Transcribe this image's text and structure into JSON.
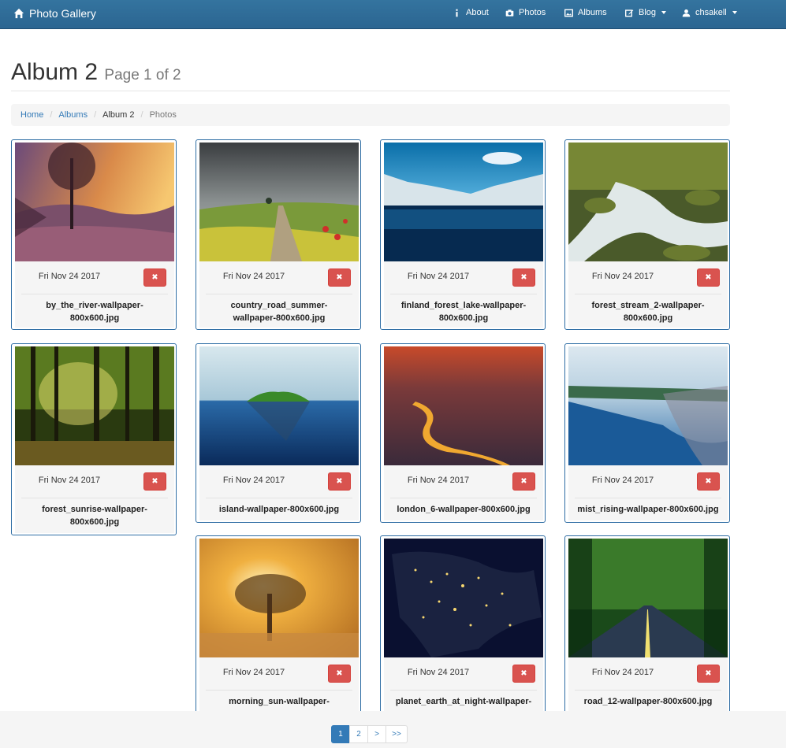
{
  "navbar": {
    "brand": "Photo Gallery",
    "items": [
      {
        "label": "About",
        "icon": "info-icon"
      },
      {
        "label": "Photos",
        "icon": "camera-icon"
      },
      {
        "label": "Albums",
        "icon": "picture-icon"
      },
      {
        "label": "Blog",
        "icon": "edit-icon",
        "dropdown": true
      },
      {
        "label": "chsakell",
        "icon": "user-icon",
        "dropdown": true
      }
    ]
  },
  "header": {
    "title": "Album 2",
    "subtitle": "Page 1 of 2"
  },
  "breadcrumb": [
    "Home",
    "Albums",
    "Album 2",
    "Photos"
  ],
  "delete_glyph": "✖",
  "photos": [
    {
      "date": "Fri Nov 24 2017",
      "line1": "by_the_river-wallpaper-",
      "line2": "800x600.jpg",
      "scene": "river-sunset"
    },
    {
      "date": "Fri Nov 24 2017",
      "line1": "country_road_summer-",
      "line2": "wallpaper-800x600.jpg",
      "scene": "country-road"
    },
    {
      "date": "Fri Nov 24 2017",
      "line1": "finland_forest_lake-wallpaper-",
      "line2": "800x600.jpg",
      "scene": "forest-lake"
    },
    {
      "date": "Fri Nov 24 2017",
      "line1": "forest_stream_2-wallpaper-",
      "line2": "800x600.jpg",
      "scene": "forest-stream"
    },
    {
      "date": "Fri Nov 24 2017",
      "line1": "forest_sunrise-wallpaper-",
      "line2": "800x600.jpg",
      "scene": "forest-sunrise"
    },
    {
      "date": "Fri Nov 24 2017",
      "line1": "island-wallpaper-800x600.jpg",
      "line2": "",
      "scene": "island"
    },
    {
      "date": "Fri Nov 24 2017",
      "line1": "london_6-wallpaper-800x600.jpg",
      "line2": "",
      "scene": "london"
    },
    {
      "date": "Fri Nov 24 2017",
      "line1": "mist_rising-wallpaper-800x600.jpg",
      "line2": "",
      "scene": "mist-rising"
    },
    {
      "date": "Fri Nov 24 2017",
      "line1": "morning_sun-wallpaper-",
      "line2": "",
      "scene": "morning-sun"
    },
    {
      "date": "Fri Nov 24 2017",
      "line1": "planet_earth_at_night-wallpaper-",
      "line2": "",
      "scene": "earth-night"
    },
    {
      "date": "Fri Nov 24 2017",
      "line1": "road_12-wallpaper-800x600.jpg",
      "line2": "",
      "scene": "forest-road"
    }
  ],
  "pagination": {
    "pages": [
      "1",
      "2",
      ">",
      ">>"
    ],
    "active": "1"
  },
  "colors": {
    "navbar": "#2e6da4",
    "delete": "#d9534f",
    "link": "#337ab7"
  }
}
